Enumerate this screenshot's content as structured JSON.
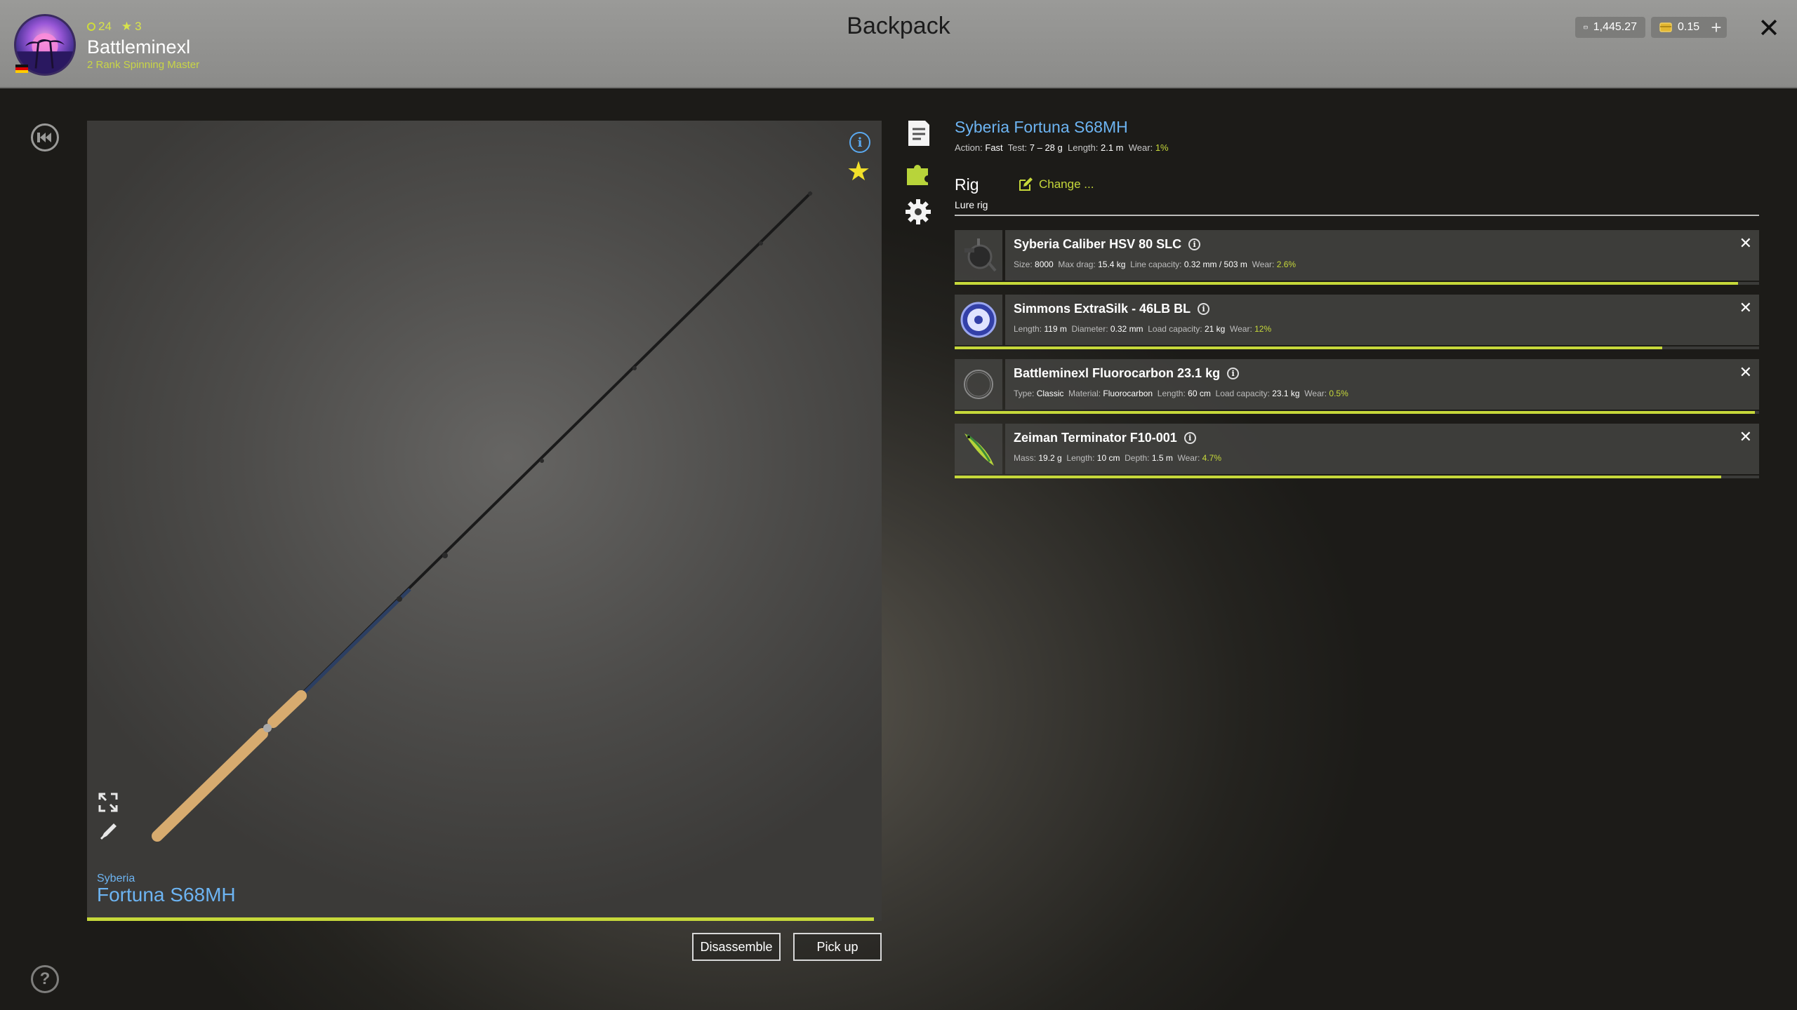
{
  "header": {
    "title": "Backpack",
    "user": {
      "level": "24",
      "stars": "3",
      "name": "Battleminexl",
      "rank": "2 Rank Spinning Master"
    },
    "silver": "1,445.27",
    "gold": "0.15",
    "plus": "+",
    "close": "✕"
  },
  "preview": {
    "brand": "Syberia",
    "name": "Fortuna S68MH",
    "wear_fraction": 0.99,
    "help": "?"
  },
  "buttons": {
    "disassemble": "Disassemble",
    "pickup": "Pick up"
  },
  "item": {
    "title": "Syberia Fortuna S68MH",
    "specs": {
      "action_label": "Action:",
      "action": "Fast",
      "test_label": "Test:",
      "test": "7 – 28 g",
      "length_label": "Length:",
      "length": "2.1 m",
      "wear_label": "Wear:",
      "wear": "1%"
    }
  },
  "rig": {
    "label": "Rig",
    "sub": "Lure rig",
    "change": "Change ..."
  },
  "parts": [
    {
      "name": "Syberia Caliber HSV 80 SLC",
      "specs": [
        {
          "label": "Size:",
          "value": "8000"
        },
        {
          "label": "Max drag:",
          "value": "15.4 kg"
        },
        {
          "label": "Line capacity:",
          "value": "0.32 mm / 503 m"
        },
        {
          "label": "Wear:",
          "value": "2.6%",
          "accent": true
        }
      ],
      "wear_fraction": 0.974
    },
    {
      "name": "Simmons ExtraSilk - 46LB BL",
      "specs": [
        {
          "label": "Length:",
          "value": "119 m"
        },
        {
          "label": "Diameter:",
          "value": "0.32 mm"
        },
        {
          "label": "Load capacity:",
          "value": "21 kg"
        },
        {
          "label": "Wear:",
          "value": "12%",
          "accent": true
        }
      ],
      "wear_fraction": 0.88
    },
    {
      "name": "Battleminexl Fluorocarbon 23.1 kg",
      "specs": [
        {
          "label": "Type:",
          "value": "Classic"
        },
        {
          "label": "Material:",
          "value": "Fluorocarbon"
        },
        {
          "label": "Length:",
          "value": "60 cm"
        },
        {
          "label": "Load capacity:",
          "value": "23.1 kg"
        },
        {
          "label": "Wear:",
          "value": "0.5%",
          "accent": true
        }
      ],
      "wear_fraction": 0.995
    },
    {
      "name": "Zeiman Terminator F10-001",
      "specs": [
        {
          "label": "Mass:",
          "value": "19.2 g"
        },
        {
          "label": "Length:",
          "value": "10 cm"
        },
        {
          "label": "Depth:",
          "value": "1.5 m"
        },
        {
          "label": "Wear:",
          "value": "4.7%",
          "accent": true
        }
      ],
      "wear_fraction": 0.953
    }
  ],
  "colors": {
    "accent": "#c6d83a",
    "link": "#6db4f2",
    "star": "#f2e02a"
  }
}
